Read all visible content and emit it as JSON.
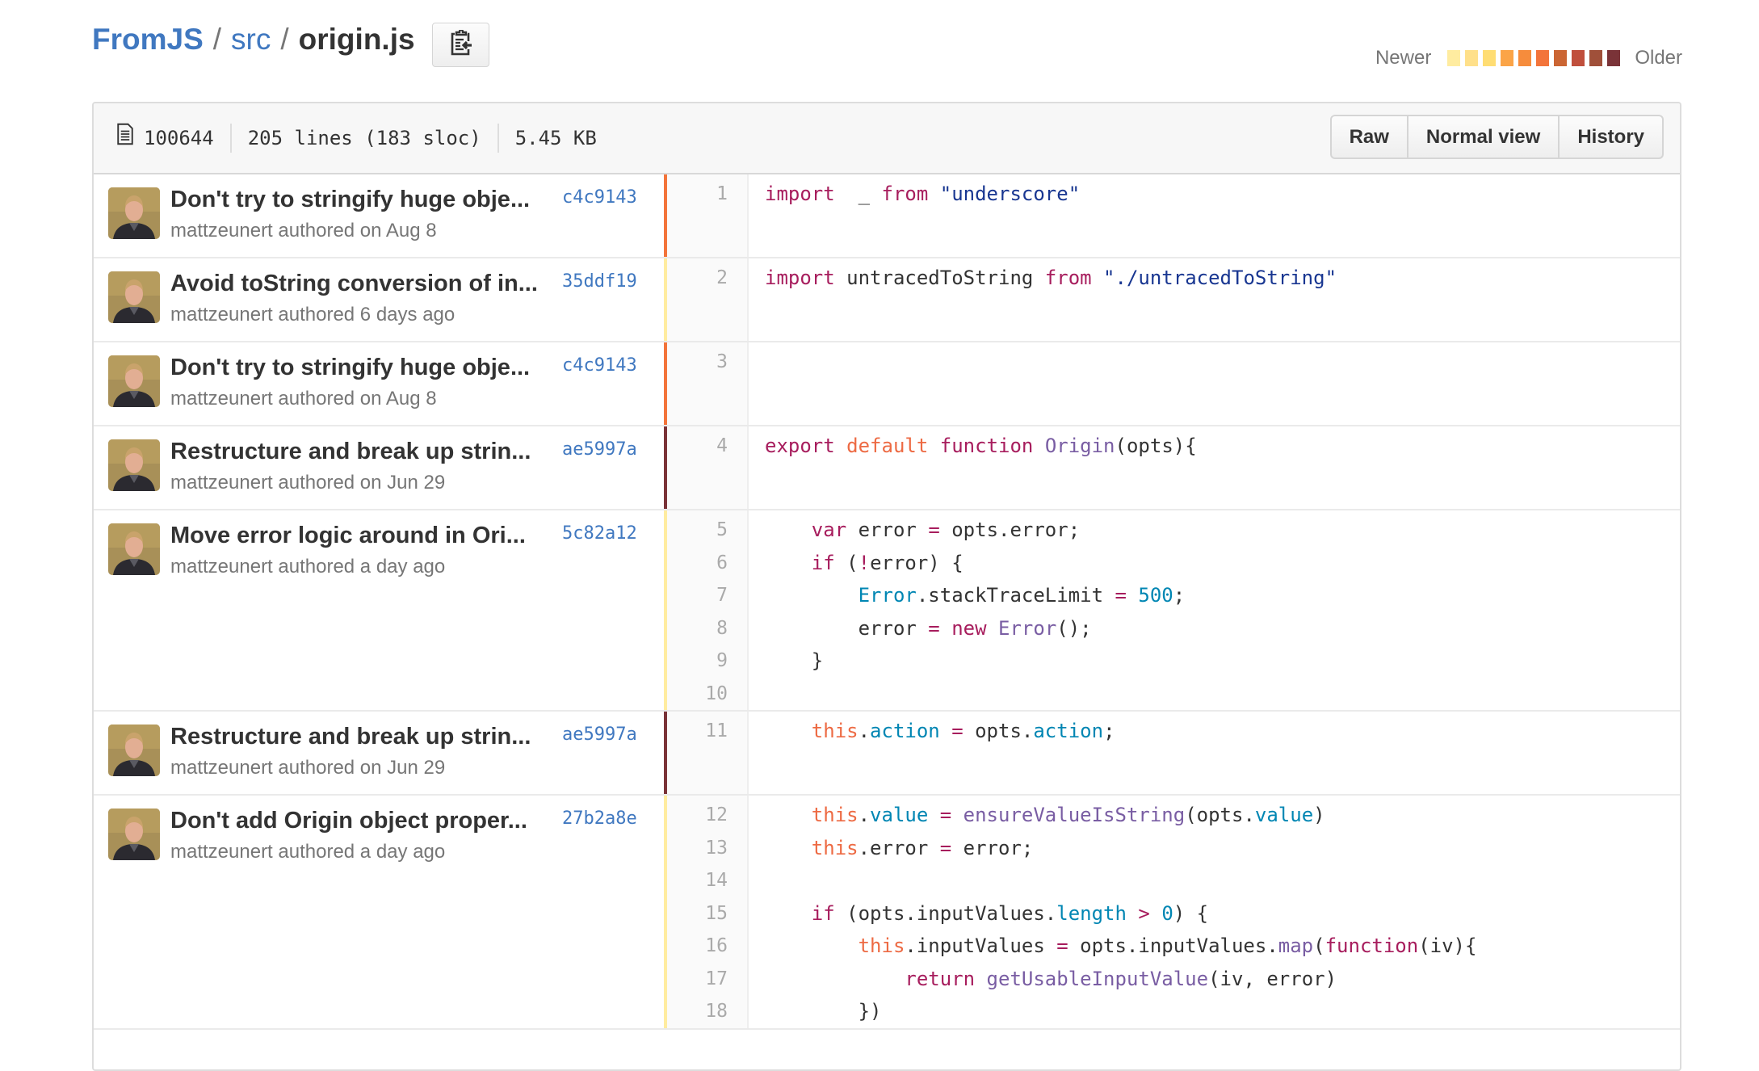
{
  "breadcrumb": {
    "repo": "FromJS",
    "dir": "src",
    "separator": "/",
    "file": "origin.js"
  },
  "copy_button": {
    "icon": "clipboard-icon"
  },
  "legend": {
    "newer_label": "Newer",
    "older_label": "Older",
    "colors": [
      "#ffeca0",
      "#ffe08a",
      "#ffdd73",
      "#fba447",
      "#f68c3c",
      "#f3743a",
      "#cb6533",
      "#c04f3c",
      "#a0503a",
      "#7a3338"
    ]
  },
  "file_header": {
    "icon": "file-text-icon",
    "mode": "100644",
    "lines": "205 lines (183 sloc)",
    "size": "5.45 KB",
    "buttons": {
      "raw": "Raw",
      "normal_view": "Normal view",
      "history": "History"
    }
  },
  "hunks": [
    {
      "message": "Don't try to stringify huge obje...",
      "meta": "mattzeunert authored on Aug 8",
      "sha": "c4c9143",
      "age_color": "#f3743a",
      "line_numbers": [
        "1"
      ],
      "code": [
        [
          [
            "k",
            "import"
          ],
          [
            "",
            "  _ "
          ],
          [
            "k",
            "from"
          ],
          [
            "",
            " "
          ],
          [
            "s",
            "\"underscore\""
          ]
        ]
      ]
    },
    {
      "message": "Avoid toString conversion of in...",
      "meta": "mattzeunert authored 6 days ago",
      "sha": "35ddf19",
      "age_color": "#ffeca0",
      "line_numbers": [
        "2"
      ],
      "code": [
        [
          [
            "k",
            "import"
          ],
          [
            "",
            " untracedToString "
          ],
          [
            "k",
            "from"
          ],
          [
            "",
            " "
          ],
          [
            "s",
            "\"./untracedToString\""
          ]
        ]
      ]
    },
    {
      "message": "Don't try to stringify huge obje...",
      "meta": "mattzeunert authored on Aug 8",
      "sha": "c4c9143",
      "age_color": "#f3743a",
      "line_numbers": [
        "3"
      ],
      "code": [
        []
      ]
    },
    {
      "message": "Restructure and break up strin...",
      "meta": "mattzeunert authored on Jun 29",
      "sha": "ae5997a",
      "age_color": "#7a3338",
      "line_numbers": [
        "4"
      ],
      "code": [
        [
          [
            "k",
            "export"
          ],
          [
            "",
            " "
          ],
          [
            "o",
            "default"
          ],
          [
            "",
            " "
          ],
          [
            "k",
            "function"
          ],
          [
            "",
            " "
          ],
          [
            "f",
            "Origin"
          ],
          [
            "",
            "(opts){"
          ]
        ]
      ]
    },
    {
      "message": "Move error logic around in Ori...",
      "meta": "mattzeunert authored a day ago",
      "sha": "5c82a12",
      "age_color": "#ffeca0",
      "line_numbers": [
        "5",
        "6",
        "7",
        "8",
        "9",
        "10"
      ],
      "code": [
        [
          [
            "",
            "    "
          ],
          [
            "k",
            "var"
          ],
          [
            "",
            " error "
          ],
          [
            "k",
            "="
          ],
          [
            "",
            " opts.error;"
          ]
        ],
        [
          [
            "",
            "    "
          ],
          [
            "k",
            "if"
          ],
          [
            "",
            " ("
          ],
          [
            "k",
            "!"
          ],
          [
            "",
            "error) {"
          ]
        ],
        [
          [
            "",
            "        "
          ],
          [
            "c",
            "Error"
          ],
          [
            "",
            ".stackTraceLimit "
          ],
          [
            "k",
            "="
          ],
          [
            "",
            " "
          ],
          [
            "c",
            "500"
          ],
          [
            "",
            ";"
          ]
        ],
        [
          [
            "",
            "        error "
          ],
          [
            "k",
            "="
          ],
          [
            "",
            " "
          ],
          [
            "k",
            "new"
          ],
          [
            "",
            " "
          ],
          [
            "f",
            "Error"
          ],
          [
            "",
            "();"
          ]
        ],
        [
          [
            "",
            "    }"
          ]
        ],
        []
      ]
    },
    {
      "message": "Restructure and break up strin...",
      "meta": "mattzeunert authored on Jun 29",
      "sha": "ae5997a",
      "age_color": "#7a3338",
      "line_numbers": [
        "11"
      ],
      "code": [
        [
          [
            "",
            "    "
          ],
          [
            "o",
            "this"
          ],
          [
            "",
            "."
          ],
          [
            "c",
            "action"
          ],
          [
            "",
            " "
          ],
          [
            "k",
            "="
          ],
          [
            "",
            " opts."
          ],
          [
            "c",
            "action"
          ],
          [
            "",
            ";"
          ]
        ]
      ]
    },
    {
      "message": "Don't add Origin object proper...",
      "meta": "mattzeunert authored a day ago",
      "sha": "27b2a8e",
      "age_color": "#ffeca0",
      "line_numbers": [
        "12",
        "13",
        "14",
        "15",
        "16",
        "17",
        "18"
      ],
      "code": [
        [
          [
            "",
            "    "
          ],
          [
            "o",
            "this"
          ],
          [
            "",
            "."
          ],
          [
            "c",
            "value"
          ],
          [
            "",
            " "
          ],
          [
            "k",
            "="
          ],
          [
            "",
            " "
          ],
          [
            "f",
            "ensureValueIsString"
          ],
          [
            "",
            "(opts."
          ],
          [
            "c",
            "value"
          ],
          [
            "",
            ")"
          ]
        ],
        [
          [
            "",
            "    "
          ],
          [
            "o",
            "this"
          ],
          [
            "",
            ".error "
          ],
          [
            "k",
            "="
          ],
          [
            "",
            " error;"
          ]
        ],
        [],
        [
          [
            "",
            "    "
          ],
          [
            "k",
            "if"
          ],
          [
            "",
            " (opts.inputValues."
          ],
          [
            "c",
            "length"
          ],
          [
            "",
            " "
          ],
          [
            "k",
            ">"
          ],
          [
            "",
            " "
          ],
          [
            "c",
            "0"
          ],
          [
            "",
            ") {"
          ]
        ],
        [
          [
            "",
            "        "
          ],
          [
            "o",
            "this"
          ],
          [
            "",
            ".inputValues "
          ],
          [
            "k",
            "="
          ],
          [
            "",
            " opts.inputValues."
          ],
          [
            "f",
            "map"
          ],
          [
            "",
            "("
          ],
          [
            "k",
            "function"
          ],
          [
            "",
            "(iv){"
          ]
        ],
        [
          [
            "",
            "            "
          ],
          [
            "k",
            "return"
          ],
          [
            "",
            " "
          ],
          [
            "f",
            "getUsableInputValue"
          ],
          [
            "",
            "(iv, error)"
          ]
        ],
        [
          [
            "",
            "        })"
          ]
        ]
      ]
    }
  ]
}
